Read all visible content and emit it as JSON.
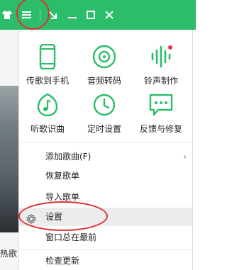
{
  "titlebar": {
    "shirt_icon": "tshirt-icon",
    "menu_icon": "hamburger-menu-icon",
    "mini_icon": "mini-mode-icon",
    "minimize_icon": "minimize-icon",
    "maximize_icon": "maximize-icon",
    "close_icon": "close-icon",
    "color": "#2bbd6a"
  },
  "background": {
    "caption": "热歌"
  },
  "menu": {
    "grid": [
      {
        "label": "传歌到手机",
        "icon": "phone-icon"
      },
      {
        "label": "音频转码",
        "icon": "disc-icon"
      },
      {
        "label": "铃声制作",
        "icon": "waveform-icon"
      },
      {
        "label": "听歌识曲",
        "icon": "music-note-icon"
      },
      {
        "label": "定时设置",
        "icon": "clock-icon"
      },
      {
        "label": "反馈与修复",
        "icon": "feedback-icon"
      }
    ],
    "add_song": "添加歌曲(F)",
    "restore": "恢复歌单",
    "import": "导入歌单",
    "settings": "设置",
    "always_on_top": "窗口总在最前",
    "check_update": "检查更新",
    "accent_color": "#2bbd6a",
    "badge_color": "#e53935"
  }
}
